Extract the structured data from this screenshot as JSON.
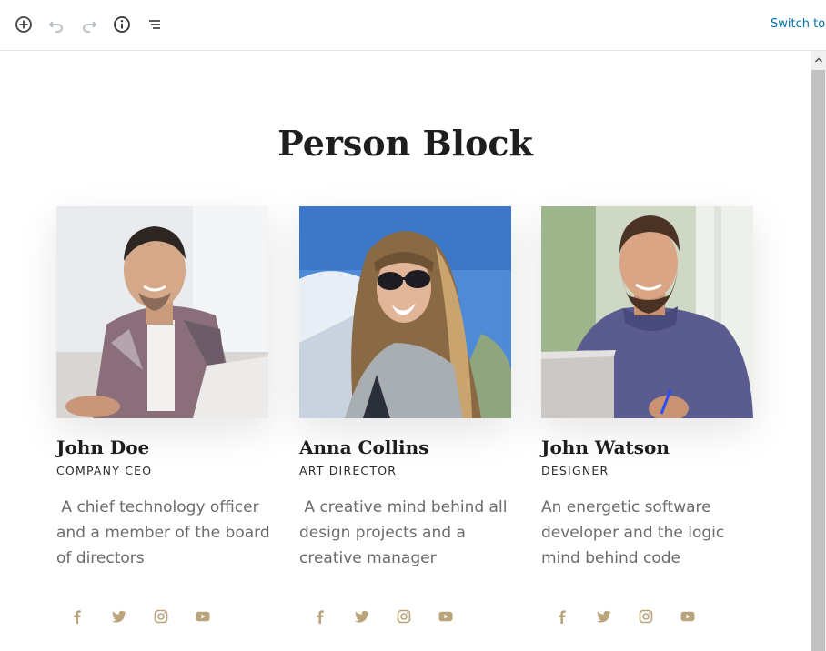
{
  "toolbar": {
    "switch_label": "Switch to D"
  },
  "page": {
    "title": "Person Block"
  },
  "colors": {
    "accent": "#0073aa",
    "social_icon": "#b9a47c",
    "title": "#1e1e1e"
  },
  "people": [
    {
      "name": "John Doe",
      "role": "COMPANY CEO",
      "bio": " A chief technology officer and a member of the board of directors",
      "socials": [
        "facebook-icon",
        "twitter-icon",
        "instagram-icon",
        "youtube-icon"
      ]
    },
    {
      "name": "Anna Collins",
      "role": "ART DIRECTOR",
      "bio": " A creative mind behind all design projects and a creative manager",
      "socials": [
        "facebook-icon",
        "twitter-icon",
        "instagram-icon",
        "youtube-icon"
      ]
    },
    {
      "name": "John Watson",
      "role": "DESIGNER",
      "bio": "An energetic software developer and the logic mind behind code",
      "socials": [
        "facebook-icon",
        "twitter-icon",
        "instagram-icon",
        "youtube-icon"
      ]
    }
  ]
}
